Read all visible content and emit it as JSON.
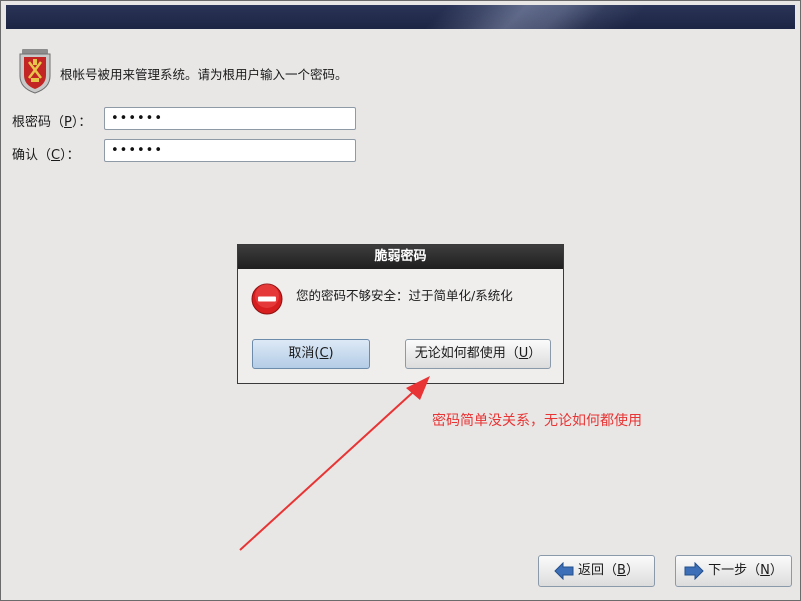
{
  "header": {
    "intro_text": "根帐号被用来管理系统。请为根用户输入一个密码。",
    "icon": "root-shield-icon"
  },
  "form": {
    "root_password_label_prefix": "根密码（",
    "root_password_mnemonic": "P",
    "root_password_label_suffix": "）：",
    "root_password_value": "••••••",
    "confirm_label_prefix": "确认（",
    "confirm_mnemonic": "C",
    "confirm_label_suffix": "）：",
    "confirm_value": "••••••"
  },
  "dialog": {
    "title": "脆弱密码",
    "icon": "error-stop-icon",
    "message": "您的密码不够安全：过于简单化/系统化",
    "cancel_prefix": "取消(",
    "cancel_mnemonic": "C",
    "cancel_suffix": ")",
    "use_prefix": "无论如何都使用（",
    "use_mnemonic": "U",
    "use_suffix": "）"
  },
  "annotation": {
    "text": "密码简单没关系，无论如何都使用",
    "color": "#e83434"
  },
  "nav": {
    "back_prefix": "返回（",
    "back_mnemonic": "B",
    "back_suffix": "）",
    "back_icon": "arrow-left-icon",
    "next_prefix": "下一步（",
    "next_mnemonic": "N",
    "next_suffix": "）",
    "next_icon": "arrow-right-icon"
  },
  "colors": {
    "banner": "#1d2544",
    "background": "#e8e7e6",
    "accent_blue": "#3d6fb8"
  }
}
